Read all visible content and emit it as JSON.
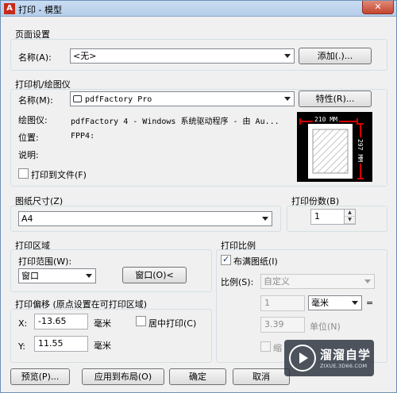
{
  "window": {
    "title": "打印 - 模型",
    "app_icon_letter": "A",
    "close_glyph": "✕"
  },
  "page_setup": {
    "section_label": "页面设置",
    "name_label": "名称(A):",
    "name_value": "<无>",
    "add_button": "添加(.)..."
  },
  "printer": {
    "section_label": "打印机/绘图仪",
    "name_label": "名称(M):",
    "name_value": "pdfFactory Pro",
    "properties_button": "特性(R)...",
    "plotter_label": "绘图仪:",
    "plotter_value": "pdfFactory 4 - Windows 系统驱动程序 - 由 Au...",
    "location_label": "位置:",
    "location_value": "FPP4:",
    "description_label": "说明:",
    "print_to_file_label": "打印到文件(F)",
    "print_to_file_checked": false,
    "preview_width": "210 MM",
    "preview_height": "297 MM"
  },
  "paper_size": {
    "section_label": "图纸尺寸(Z)",
    "value": "A4"
  },
  "copies": {
    "section_label": "打印份数(B)",
    "value": "1"
  },
  "plot_area": {
    "section_label": "打印区域",
    "range_label": "打印范围(W):",
    "range_value": "窗口",
    "window_button": "窗口(O)<"
  },
  "plot_offset": {
    "section_label": "打印偏移 (原点设置在可打印区域)",
    "x_label": "X:",
    "x_value": "-13.65",
    "x_unit": "毫米",
    "y_label": "Y:",
    "y_value": "11.55",
    "y_unit": "毫米",
    "center_label": "居中打印(C)",
    "center_checked": false
  },
  "plot_scale": {
    "section_label": "打印比例",
    "fit_label": "布满图纸(I)",
    "fit_checked": true,
    "scale_label": "比例(S):",
    "scale_value": "自定义",
    "value1": "1",
    "unit1": "毫米",
    "equals": "=",
    "value2": "3.39",
    "unit2": "单位(N)",
    "lineweight_label": "缩"
  },
  "footer": {
    "preview_button": "预览(P)...",
    "apply_button": "应用到布局(O)",
    "ok_button": "确定",
    "cancel_button": "取消"
  },
  "watermark": {
    "title": "溜溜自学",
    "url": "ZIXUE.3D66.COM"
  },
  "colors": {
    "accent_red": "#d40000",
    "title_gradient": "#c9dcf3",
    "close_red": "#c4452f"
  }
}
